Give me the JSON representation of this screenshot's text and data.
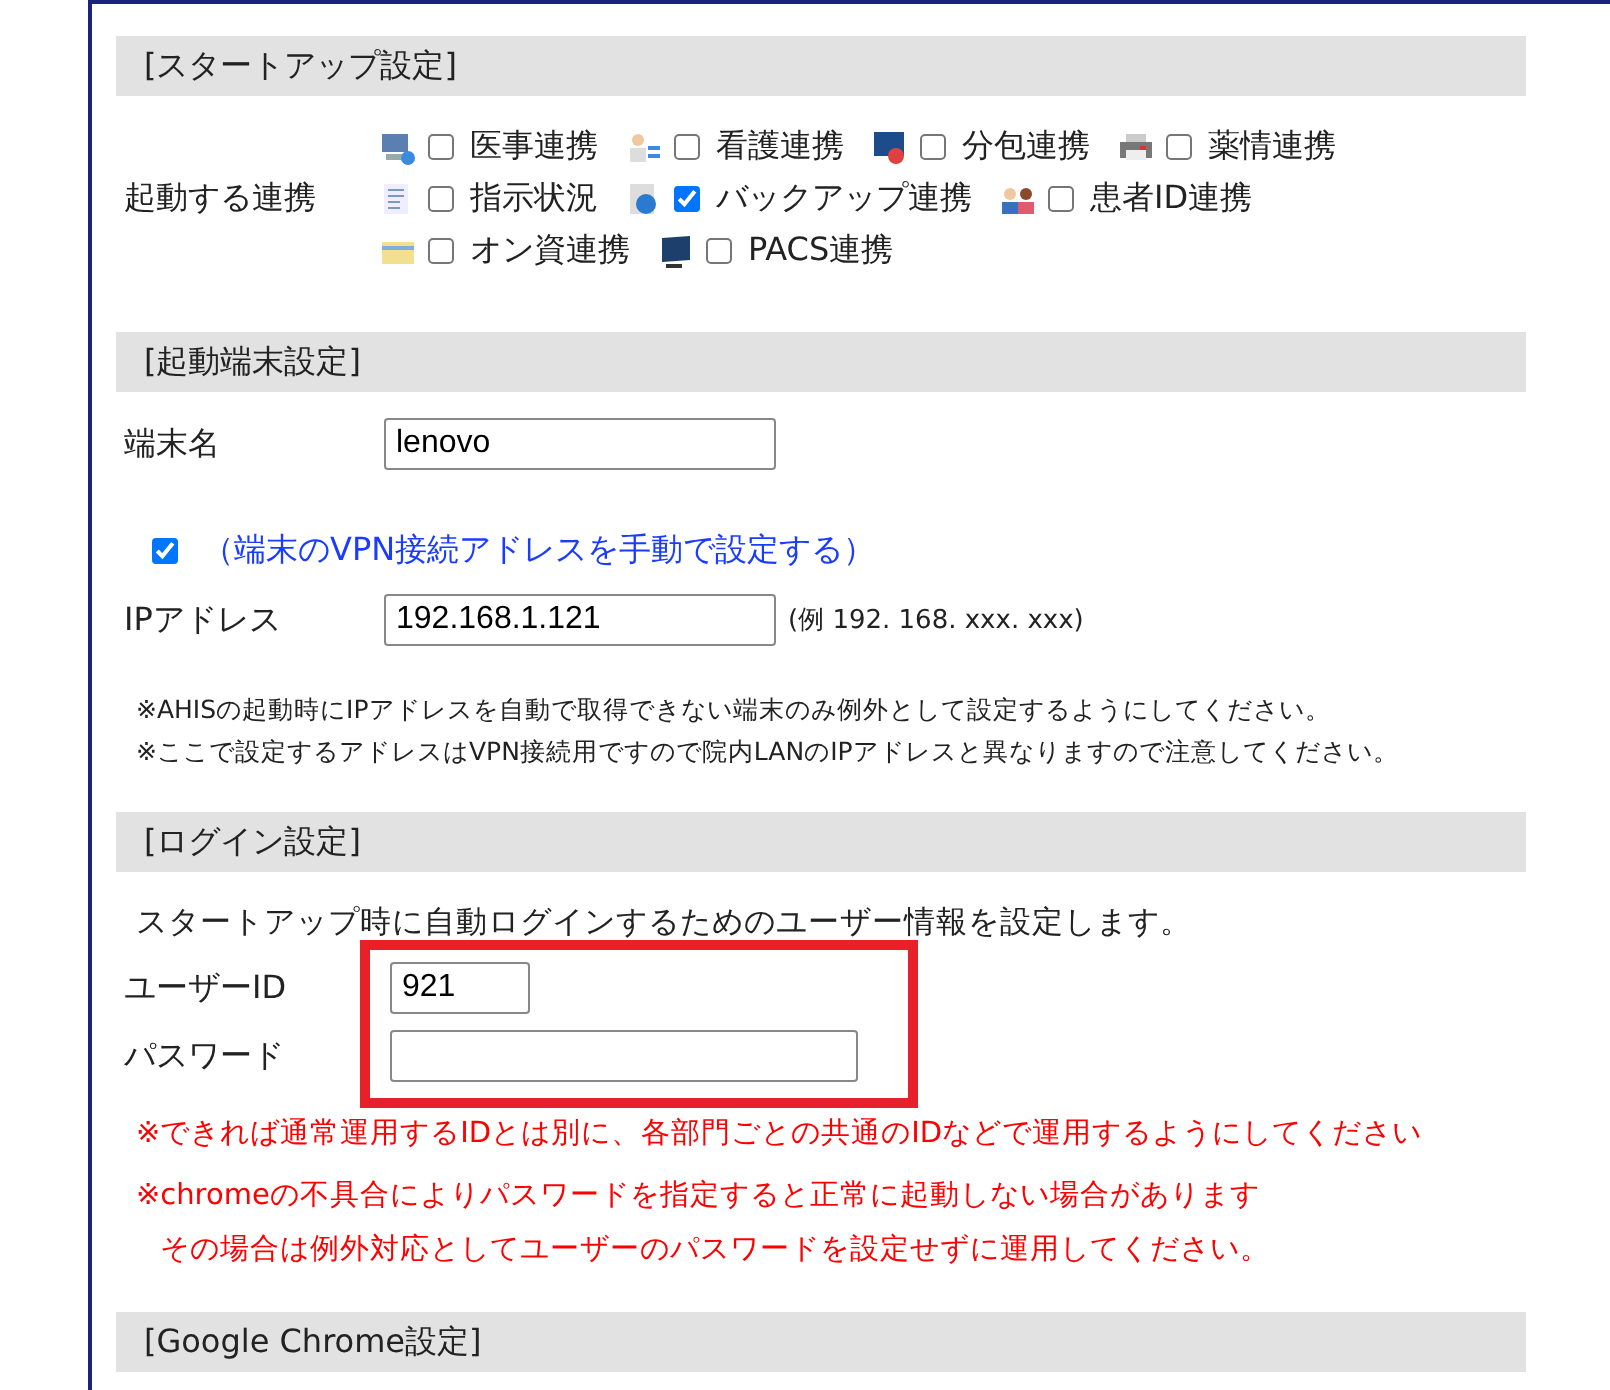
{
  "startup": {
    "header": "[スタートアップ設定]",
    "label": "起動する連携",
    "rows": [
      [
        {
          "kind": "computer",
          "label": "医事連携",
          "checked": false
        },
        {
          "kind": "nurse",
          "label": "看護連携",
          "checked": false
        },
        {
          "kind": "monitor",
          "label": "分包連携",
          "checked": false
        },
        {
          "kind": "printer",
          "label": "薬情連携",
          "checked": false
        }
      ],
      [
        {
          "kind": "list",
          "label": "指示状況",
          "checked": false
        },
        {
          "kind": "globe",
          "label": "バックアップ連携",
          "checked": true
        },
        {
          "kind": "people",
          "label": "患者ID連携",
          "checked": false
        }
      ],
      [
        {
          "kind": "card",
          "label": "オン資連携",
          "checked": false
        },
        {
          "kind": "display",
          "label": "PACS連携",
          "checked": false
        }
      ]
    ]
  },
  "terminal": {
    "header": "[起動端末設定]",
    "name_label": "端末名",
    "name_value": "lenovo",
    "manual": {
      "label": "（端末のVPN接続アドレスを手動で設定する）",
      "checked": true
    },
    "ip_label": "IPアドレス",
    "ip_value": "192.168.1.121",
    "ip_example": "(例 192. 168. xxx. xxx)",
    "notes": [
      "※AHISの起動時にIPアドレスを自動で取得できない端末のみ例外として設定するようにしてください。",
      "※ここで設定するアドレスはVPN接続用ですので院内LANのIPアドレスと異なりますので注意してください。"
    ]
  },
  "login": {
    "header": "[ログイン設定]",
    "description": "スタートアップ時に自動ログインするためのユーザー情報を設定します。",
    "user_label": "ユーザーID",
    "user_value": "921",
    "password_label": "パスワード",
    "highlighted": true,
    "warnings": [
      [
        "※できれば通常運用するIDとは別に、各部門ごとの共通のIDなどで運用するようにしてください"
      ],
      [
        "※chromeの不具合によりパスワードを指定すると正常に起動しない場合があります",
        "その場合は例外対応としてユーザーのパスワードを設定せずに運用してください。"
      ]
    ]
  },
  "chrome": {
    "header": "[Google Chrome設定]"
  }
}
